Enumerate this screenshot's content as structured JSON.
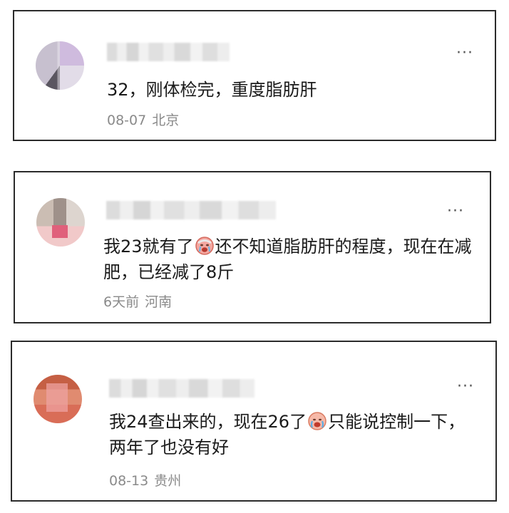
{
  "comments": [
    {
      "text": "32，刚体检完，重度脂肪肝",
      "date": "08-07",
      "location": "北京",
      "more_label": "···"
    },
    {
      "text_before": "我23就有了",
      "emoji": "crying-face-emoji",
      "text_after": "还不知道脂肪肝的程度，现在在减肥，已经减了8斤",
      "date": "6天前",
      "location": "河南",
      "more_label": "···"
    },
    {
      "text_before": "我24查出来的，现在26了",
      "emoji": "crying-face-emoji",
      "text_after": "只能说控制一下，两年了也没有好",
      "date": "08-13",
      "location": "贵州",
      "more_label": "···"
    }
  ]
}
